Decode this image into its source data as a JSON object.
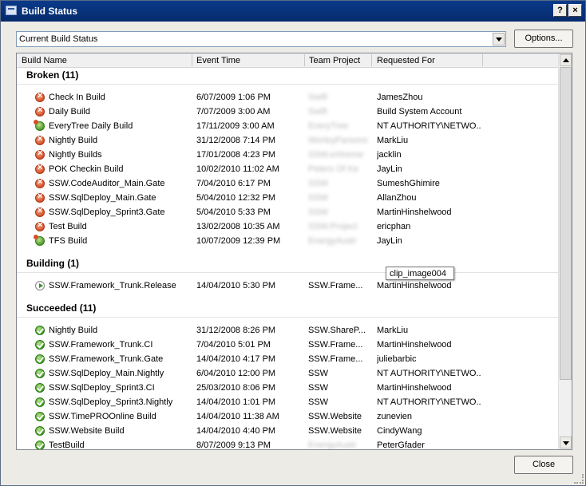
{
  "window": {
    "title": "Build Status",
    "help_label": "?",
    "close_label": "×"
  },
  "filter": {
    "selected": "Current Build Status",
    "options_label": "Options..."
  },
  "columns": [
    "Build Name",
    "Event Time",
    "Team Project",
    "Requested For"
  ],
  "groups": [
    {
      "label": "Broken (11)",
      "rows": [
        {
          "name": "Check In Build",
          "time": "6/07/2009 1:06 PM",
          "project": "Swift",
          "requested": "JamesZhou",
          "status": "broken",
          "blur": true
        },
        {
          "name": "Daily Build",
          "time": "7/07/2009 3:00 AM",
          "project": "Swift",
          "requested": "Build System Account",
          "status": "broken",
          "blur": true
        },
        {
          "name": "EveryTree Daily Build",
          "time": "17/11/2009 3:00 AM",
          "project": "EveryTree",
          "requested": "NT AUTHORITY\\NETWO...",
          "status": "partial",
          "blur": true
        },
        {
          "name": "Nightly Build",
          "time": "31/12/2008 7:14 PM",
          "project": "WorleyParsons",
          "requested": "MarkLiu",
          "status": "broken",
          "blur": true
        },
        {
          "name": "Nightly Builds",
          "time": "17/01/2008 4:23 PM",
          "project": "SSW.eXtreme",
          "requested": "jacklin",
          "status": "broken",
          "blur": true
        },
        {
          "name": "POK Checkin Build",
          "time": "10/02/2010 11:02 AM",
          "project": "Peters Of Ke",
          "requested": "JayLin",
          "status": "broken",
          "blur": true
        },
        {
          "name": "SSW.CodeAuditor_Main.Gate",
          "time": "7/04/2010 6:17 PM",
          "project": "SSW",
          "requested": "SumeshGhimire",
          "status": "broken",
          "blur": true
        },
        {
          "name": "SSW.SqlDeploy_Main.Gate",
          "time": "5/04/2010 12:32 PM",
          "project": "SSW",
          "requested": "AllanZhou",
          "status": "broken",
          "blur": true
        },
        {
          "name": "SSW.SqlDeploy_Sprint3.Gate",
          "time": "5/04/2010 5:33 PM",
          "project": "SSW",
          "requested": "MartinHinshelwood",
          "status": "broken",
          "blur": true
        },
        {
          "name": "Test Build",
          "time": "13/02/2008 10:35 AM",
          "project": "SSW.Project",
          "requested": "ericphan",
          "status": "broken",
          "blur": true
        },
        {
          "name": "TFS Build",
          "time": "10/07/2009 12:39 PM",
          "project": "EnergyAustr",
          "requested": "JayLin",
          "status": "partial",
          "blur": true
        }
      ]
    },
    {
      "label": "Building (1)",
      "rows": [
        {
          "name": "SSW.Framework_Trunk.Release",
          "time": "14/04/2010 5:30 PM",
          "project": "SSW.Frame...",
          "requested": "MartinHinshelwood",
          "status": "building",
          "blur": false
        }
      ]
    },
    {
      "label": "Succeeded (11)",
      "rows": [
        {
          "name": "Nightly Build",
          "time": "31/12/2008 8:26 PM",
          "project": "SSW.ShareP...",
          "requested": "MarkLiu",
          "status": "succeeded",
          "blur": false
        },
        {
          "name": "SSW.Framework_Trunk.CI",
          "time": "7/04/2010 5:01 PM",
          "project": "SSW.Frame...",
          "requested": "MartinHinshelwood",
          "status": "succeeded",
          "blur": false
        },
        {
          "name": "SSW.Framework_Trunk.Gate",
          "time": "14/04/2010 4:17 PM",
          "project": "SSW.Frame...",
          "requested": "juliebarbic",
          "status": "succeeded",
          "blur": false
        },
        {
          "name": "SSW.SqlDeploy_Main.Nightly",
          "time": "6/04/2010 12:00 PM",
          "project": "SSW",
          "requested": "NT AUTHORITY\\NETWO...",
          "status": "succeeded",
          "blur": false
        },
        {
          "name": "SSW.SqlDeploy_Sprint3.CI",
          "time": "25/03/2010 8:06 PM",
          "project": "SSW",
          "requested": "MartinHinshelwood",
          "status": "succeeded",
          "blur": false
        },
        {
          "name": "SSW.SqlDeploy_Sprint3.Nightly",
          "time": "14/04/2010 1:01 PM",
          "project": "SSW",
          "requested": "NT AUTHORITY\\NETWO...",
          "status": "succeeded",
          "blur": false
        },
        {
          "name": "SSW.TimePROOnline Build",
          "time": "14/04/2010 11:38 AM",
          "project": "SSW.Website",
          "requested": "zunevien",
          "status": "succeeded",
          "blur": false
        },
        {
          "name": "SSW.Website Build",
          "time": "14/04/2010 4:40 PM",
          "project": "SSW.Website",
          "requested": "CindyWang",
          "status": "succeeded",
          "blur": false
        },
        {
          "name": "TestBuild",
          "time": "8/07/2009 9:13 PM",
          "project": "EnergyAustr",
          "requested": "PeterGfader",
          "status": "succeeded",
          "blur": true
        }
      ]
    }
  ],
  "tooltip": "clip_image004",
  "footer": {
    "close_label": "Close"
  },
  "colors": {
    "titlebar": "#0a3a8a",
    "broken": "#d64f27",
    "succeeded": "#3f9a20"
  }
}
